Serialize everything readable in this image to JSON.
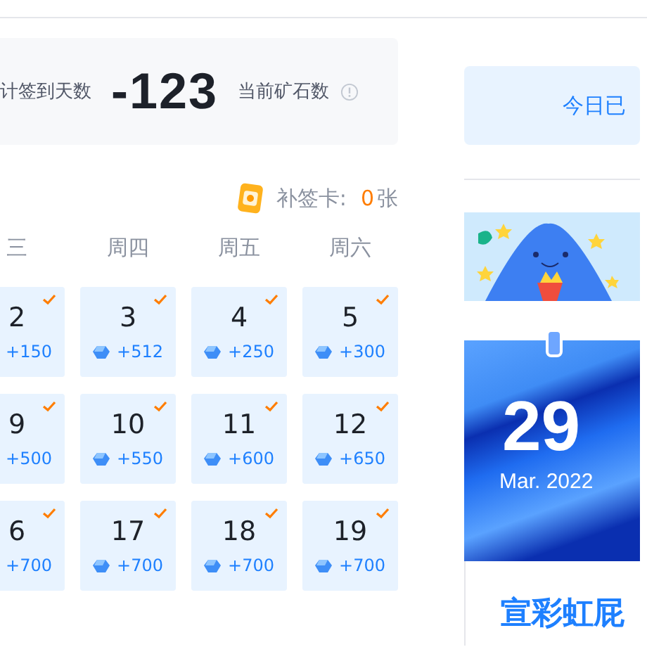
{
  "stats": {
    "days_label": "计签到天数",
    "ore_value": "-123",
    "ore_label": "当前矿石数"
  },
  "makeup_card": {
    "label": "补签卡:",
    "count": "0",
    "unit": "张"
  },
  "weekdays": [
    "三",
    "周四",
    "周五",
    "周六"
  ],
  "days": [
    {
      "day": "2",
      "points": "+150",
      "checked": true
    },
    {
      "day": "3",
      "points": "+512",
      "checked": true
    },
    {
      "day": "4",
      "points": "+250",
      "checked": true
    },
    {
      "day": "5",
      "points": "+300",
      "checked": true
    },
    {
      "day": "9",
      "points": "+500",
      "checked": true
    },
    {
      "day": "10",
      "points": "+550",
      "checked": true
    },
    {
      "day": "11",
      "points": "+600",
      "checked": true
    },
    {
      "day": "12",
      "points": "+650",
      "checked": true
    },
    {
      "day": "6",
      "points": "+700",
      "checked": true
    },
    {
      "day": "17",
      "points": "+700",
      "checked": true
    },
    {
      "day": "18",
      "points": "+700",
      "checked": true
    },
    {
      "day": "19",
      "points": "+700",
      "checked": true
    }
  ],
  "signin_button": "今日已",
  "calendar_card": {
    "day": "29",
    "month": "Mar. 2022",
    "title": "宣彩虹屁"
  }
}
